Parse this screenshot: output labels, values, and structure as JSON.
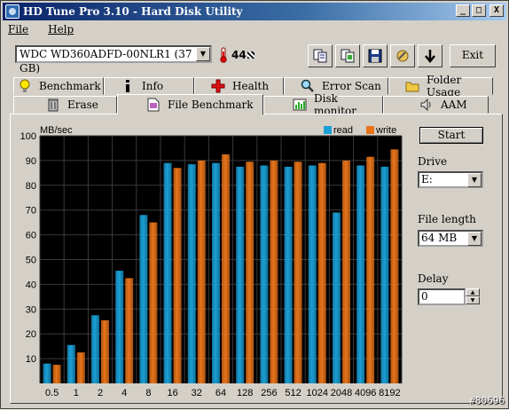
{
  "window": {
    "title": "HD Tune Pro 3.10 - Hard Disk Utility",
    "min_label": "_",
    "max_label": "□",
    "close_label": "X"
  },
  "menu": {
    "file": "File",
    "help": "Help"
  },
  "toolbar": {
    "drive": "WDC WD360ADFD-00NLR1 (37 GB)",
    "temperature": "44",
    "temperature_unit_icon": "celsius-icon",
    "exit_label": "Exit"
  },
  "tabs": {
    "row1": [
      {
        "label": "Benchmark",
        "icon": "lightbulb-icon"
      },
      {
        "label": "Info",
        "icon": "info-icon"
      },
      {
        "label": "Health",
        "icon": "red-cross-icon"
      },
      {
        "label": "Error Scan",
        "icon": "magnifier-icon"
      },
      {
        "label": "Folder Usage",
        "icon": "folder-icon"
      }
    ],
    "row2": [
      {
        "label": "Erase",
        "icon": "trash-icon"
      },
      {
        "label": "File Benchmark",
        "icon": "file-icon",
        "active": true
      },
      {
        "label": "Disk monitor",
        "icon": "monitor-chart-icon"
      },
      {
        "label": "AAM",
        "icon": "speaker-icon"
      }
    ]
  },
  "controls": {
    "start_label": "Start",
    "drive_label": "Drive",
    "drive_value": "E:",
    "file_length_label": "File length",
    "file_length_value": "64 MB",
    "delay_label": "Delay",
    "delay_value": "0"
  },
  "chart_data": {
    "type": "bar",
    "ylabel": "MB/sec",
    "ylim": [
      0,
      100
    ],
    "yticks": [
      10,
      20,
      30,
      40,
      50,
      60,
      70,
      80,
      90,
      100
    ],
    "grid": true,
    "legend_position": "top-right",
    "categories": [
      "0.5",
      "1",
      "2",
      "4",
      "8",
      "16",
      "32",
      "64",
      "128",
      "256",
      "512",
      "1024",
      "2048",
      "4096",
      "8192"
    ],
    "series": [
      {
        "name": "read",
        "color": "#1a9fd6",
        "values": [
          8,
          15.5,
          27.5,
          45.5,
          68,
          89,
          88.5,
          89,
          87.5,
          88,
          87.5,
          88,
          69,
          88,
          87.5
        ]
      },
      {
        "name": "write",
        "color": "#e8741a",
        "values": [
          7.5,
          12.5,
          25.5,
          42.5,
          65,
          87,
          90,
          92.5,
          89.5,
          90,
          89.5,
          89,
          90,
          91.5,
          94.5
        ]
      }
    ]
  },
  "watermark": "#80696"
}
